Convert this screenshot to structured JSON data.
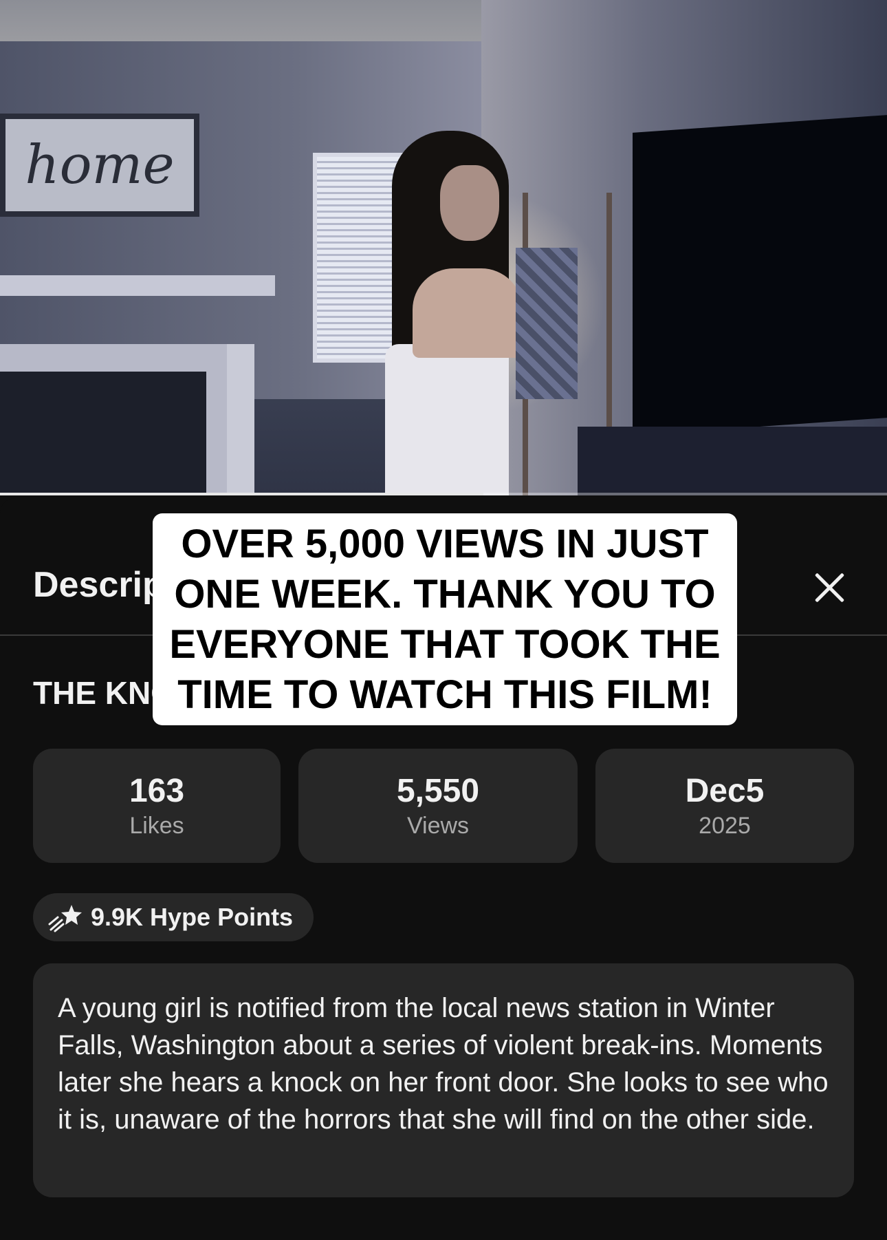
{
  "video": {
    "sign_text": "home",
    "progress_fraction": 0.545
  },
  "overlay_caption": "OVER 5,000 VIEWS IN JUST ONE WEEK. THANK YOU TO EVERYONE THAT TOOK THE TIME TO WATCH THIS FILM!",
  "sheet": {
    "title": "Description",
    "close_icon": "close-icon"
  },
  "video_title": "THE KNOCK",
  "stats": {
    "likes_value": "163",
    "likes_label": "Likes",
    "views_value": "5,550",
    "views_label": "Views",
    "date_value": "Dec5",
    "date_label": "2025"
  },
  "hype": {
    "icon": "shooting-star-icon",
    "label": "9.9K Hype Points"
  },
  "description": "A young girl is notified from the local news station in Winter Falls, Washington about a series of violent break-ins. Moments later she hears a knock on her front door. She looks to see who it is, unaware of the horrors that she will find on the other side.",
  "colors": {
    "background": "#0f0f0f",
    "card": "#272727",
    "text_primary": "#f1f1f1",
    "text_secondary": "#aaaaaa",
    "overlay_bg": "#ffffff"
  }
}
